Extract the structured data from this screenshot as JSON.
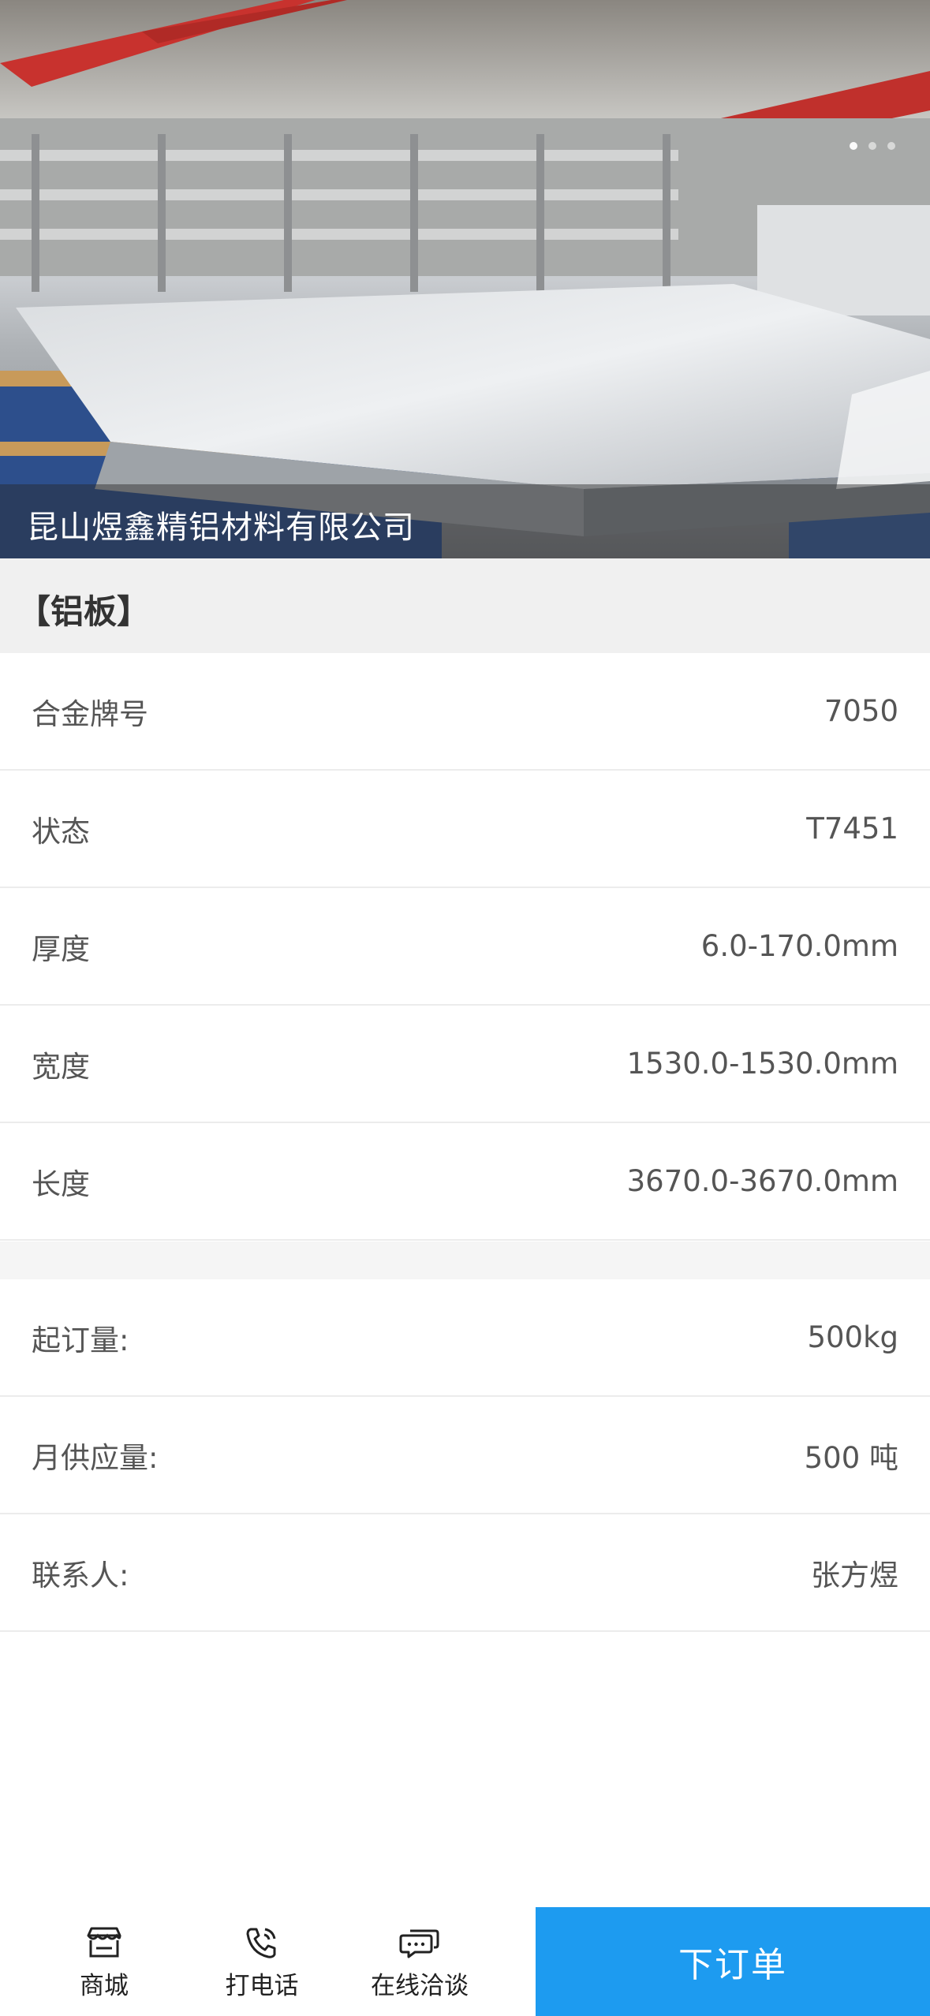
{
  "hero": {
    "company_name": "昆山煜鑫精铝材料有限公司"
  },
  "category": {
    "label": "【铝板】"
  },
  "specs": [
    {
      "key": "合金牌号",
      "value": "7050"
    },
    {
      "key": "状态",
      "value": "T7451"
    },
    {
      "key": "厚度",
      "value": "6.0-170.0mm"
    },
    {
      "key": "宽度",
      "value": "1530.0-1530.0mm"
    },
    {
      "key": "长度",
      "value": "3670.0-3670.0mm"
    }
  ],
  "supply": [
    {
      "key": "起订量:",
      "value": "500kg"
    },
    {
      "key": "月供应量:",
      "value": "500 吨"
    },
    {
      "key": "联系人:",
      "value": "张方煜"
    }
  ],
  "bottom_bar": {
    "tabs": [
      {
        "label": "商城",
        "icon": "store-icon"
      },
      {
        "label": "打电话",
        "icon": "phone-icon"
      },
      {
        "label": "在线洽谈",
        "icon": "chat-icon"
      }
    ],
    "order_button": "下订单"
  },
  "colors": {
    "accent": "#1d9bf0",
    "category_bg": "#f0f0f0",
    "text": "#555555"
  }
}
